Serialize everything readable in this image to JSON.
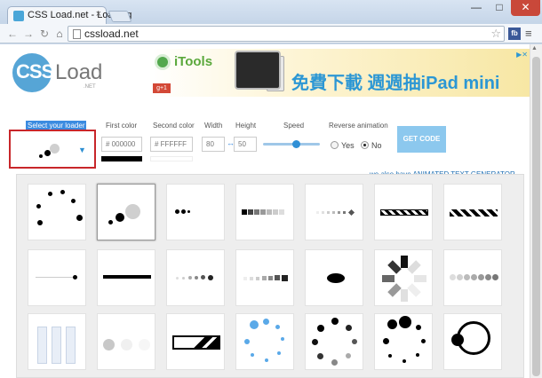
{
  "browser": {
    "tab_title": "CSS Load.net - Loading",
    "tab_close": "×",
    "url": "cssload.net",
    "ext_label": "fb",
    "min_label": "—",
    "max_label": "□",
    "close_label": "✕"
  },
  "logo": {
    "css": "CSS",
    "load": "Load",
    "net": ".NET"
  },
  "ad": {
    "brand": "iTools",
    "gplus": "g+1",
    "slogan": "免費下載 週週抽iPad mini",
    "adchoice": "▶✕"
  },
  "controls": {
    "select_label": "Select your loader",
    "first_color_label": "First color",
    "first_color_value": "# 000000",
    "second_color_label": "Second color",
    "second_color_value": "# FFFFFF",
    "width_label": "Width",
    "width_value": "80",
    "height_label": "Height",
    "height_value": "50",
    "speed_label": "Speed",
    "speed_level": 0.6,
    "reverse_label": "Reverse animation",
    "yes_label": "Yes",
    "no_label": "No",
    "reverse_selected": "No",
    "get_code_label": "GET CODE",
    "first_color_hex": "#000000",
    "second_color_hex": "#FFFFFF"
  },
  "animated_text_link": "we also have ANIMATED TEXT GENERATOR",
  "icons": [
    "page-icon",
    "star-icon",
    "menu-icon",
    "back-icon",
    "forward-icon",
    "reload-icon",
    "home-icon",
    "chevron-down-icon"
  ]
}
